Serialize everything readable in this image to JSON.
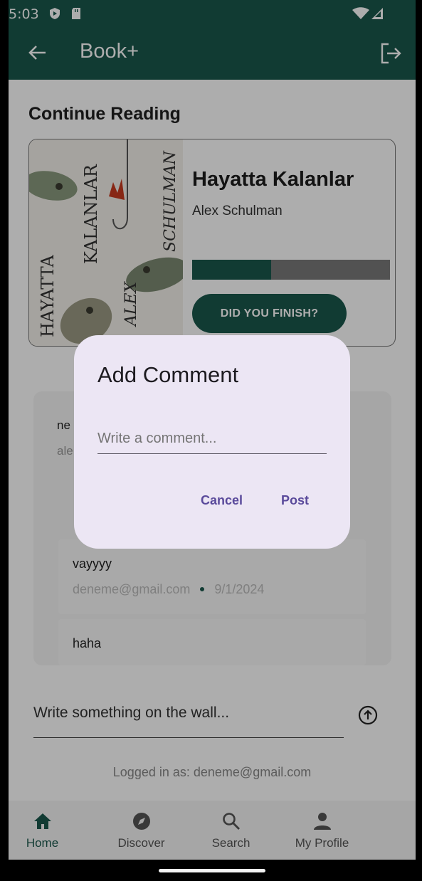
{
  "status": {
    "time": "5:03"
  },
  "app": {
    "title": "Book+"
  },
  "continue_reading": {
    "heading": "Continue Reading",
    "book": {
      "title": "Hayatta Kalanlar",
      "author": "Alex Schulman",
      "progress": 0.4,
      "cover_text": [
        "HAYATTA",
        "KALANLAR",
        "ALEX",
        "SCHULMAN"
      ]
    },
    "finish_label": "DID YOU FINISH?"
  },
  "wall": {
    "top_post": {
      "text": "ne",
      "sub": "ale"
    },
    "comments": [
      {
        "text": "vayyyy",
        "author": "deneme@gmail.com",
        "date": "9/1/2024"
      },
      {
        "text": "haha",
        "author": "",
        "date": ""
      }
    ],
    "input_placeholder": "Write something on the wall..."
  },
  "logged_in": "Logged in as: deneme@gmail.com",
  "nav": [
    {
      "label": "Home",
      "icon": "home-icon",
      "active": true
    },
    {
      "label": "Discover",
      "icon": "compass-icon",
      "active": false
    },
    {
      "label": "Search",
      "icon": "search-icon",
      "active": false
    },
    {
      "label": "My Profile",
      "icon": "person-icon",
      "active": false
    }
  ],
  "dialog": {
    "title": "Add Comment",
    "placeholder": "Write a comment...",
    "cancel": "Cancel",
    "post": "Post"
  },
  "colors": {
    "primary": "#1a574c",
    "dialog_bg": "#ece6f4",
    "dialog_accent": "#5a4a9b"
  }
}
